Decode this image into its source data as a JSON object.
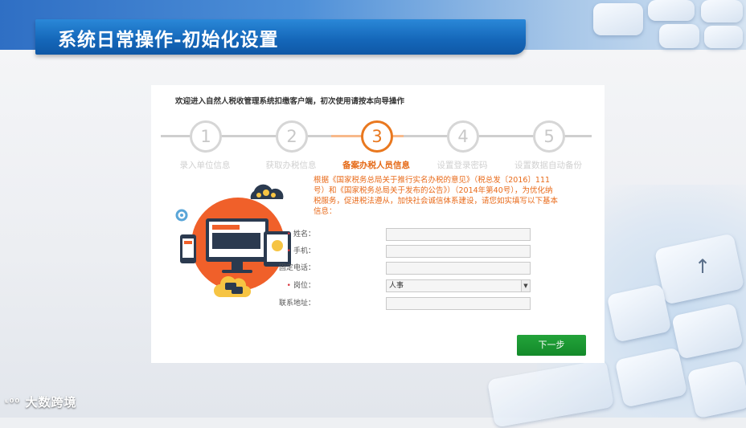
{
  "header": {
    "title": "系统日常操作-初始化设置"
  },
  "wizard": {
    "welcome": "欢迎进入自然人税收管理系统扣缴客户端，初次使用请按本向导操作",
    "steps": [
      {
        "num": "1",
        "label": "录入单位信息"
      },
      {
        "num": "2",
        "label": "获取办税信息"
      },
      {
        "num": "3",
        "label": "备案办税人员信息"
      },
      {
        "num": "4",
        "label": "设置登录密码"
      },
      {
        "num": "5",
        "label": "设置数据自动备份"
      }
    ],
    "active_step": 3,
    "notice": "根据《国家税务总局关于推行实名办税的意见》（税总发〔2016〕111号）和《国家税务总局关于发布的公告》）（2014年第40号），为优化纳税服务，促进税法遵从，加快社会诚信体系建设，请您如实填写以下基本信息："
  },
  "form": {
    "name_label": "姓名：",
    "name_value": "",
    "mobile_label": "手机：",
    "mobile_value": "",
    "phone_label": "固定电话：",
    "phone_value": "",
    "position_label": "岗位：",
    "position_value": "人事",
    "address_label": "联系地址：",
    "address_value": "",
    "required_mark": "•",
    "next_button": "下一步"
  },
  "watermark": "大数跨境",
  "colors": {
    "accent": "#e9781f",
    "banner": "#1466b8",
    "button": "#1a9633"
  }
}
